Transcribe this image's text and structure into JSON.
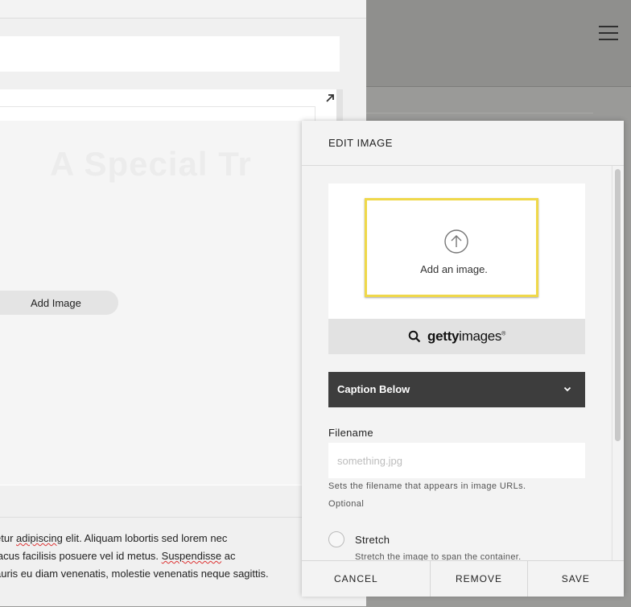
{
  "editor": {
    "add_image_label": "Add Image",
    "ghost_title": "A Special Tr",
    "body_lines": [
      {
        "pre": "etur ",
        "sq": "adipiscing",
        "post": " elit. Aliquam lobortis sed lorem nec"
      },
      {
        "pre": "lacus facilisis posuere vel id metus. ",
        "sq": "Suspendisse",
        "post": " ac"
      },
      {
        "pre": "auris eu diam venenatis, molestie venenatis neque sagittis.",
        "sq": "",
        "post": ""
      }
    ]
  },
  "dialog": {
    "title": "EDIT IMAGE",
    "upload_label": "Add an image.",
    "getty": {
      "brand_bold": "getty",
      "brand_light": "images",
      "reg": "®"
    },
    "caption_select": {
      "selected": "Caption Below"
    },
    "filename": {
      "label": "Filename",
      "placeholder": "something.jpg",
      "value": "",
      "help": "Sets the filename that appears in image URLs.",
      "optional": "Optional"
    },
    "stretch": {
      "label": "Stretch",
      "description": "Stretch the image to span the container."
    },
    "footer": {
      "cancel": "CANCEL",
      "remove": "REMOVE",
      "save": "SAVE"
    }
  },
  "colors": {
    "upload_highlight": "#efd84a",
    "caption_select_bg": "#3d3d3d",
    "overlay": "#9a9a98"
  },
  "icons": {
    "upload": "arrow-up-circle-icon",
    "getty_search": "search-icon",
    "caption_chevron": "chevron-down-icon",
    "expand": "expand-arrow-icon",
    "menu": "hamburger-icon"
  }
}
